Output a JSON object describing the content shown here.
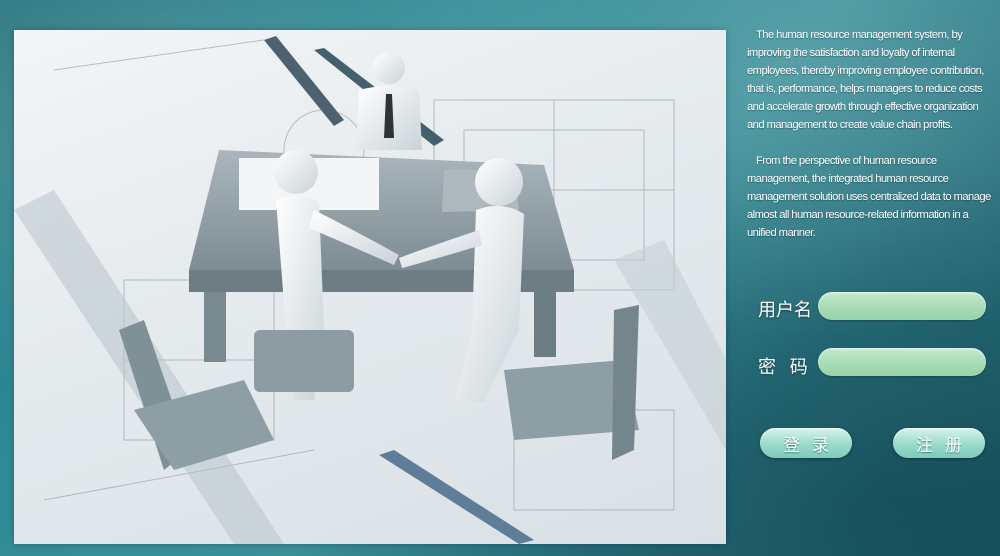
{
  "intro": {
    "paragraph1": "The human resource management system, by improving the satisfaction and loyalty of internal employees, thereby improving employee contribution, that is, performance, helps managers to reduce costs and accelerate growth through effective organization and management to create value chain profits.",
    "paragraph2": "From the perspective of human resource management, the integrated human resource management solution uses centralized data to manage almost all human resource-related information in a unified manner."
  },
  "login": {
    "username_label": "用户名",
    "username_value": "",
    "password_label": "密 码",
    "password_value": "",
    "login_button": "登录",
    "register_button": "注册"
  },
  "colors": {
    "background": "#2f8b96",
    "input_fill": "#a7dcb6",
    "button_fill": "#9fdccd"
  }
}
